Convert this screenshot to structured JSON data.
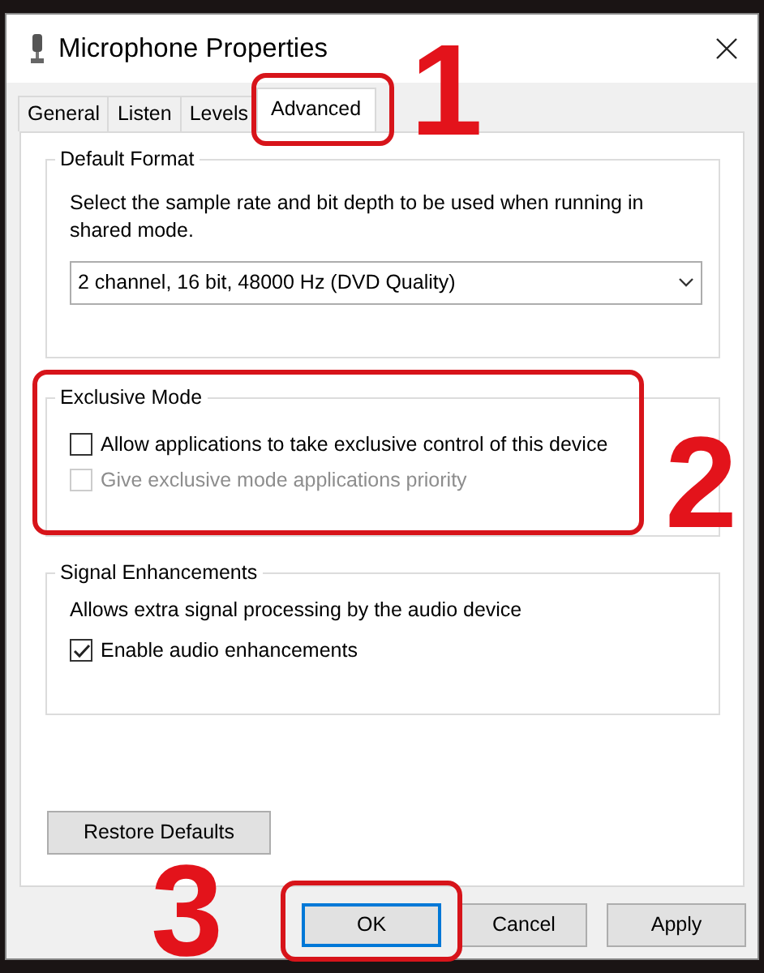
{
  "window": {
    "title": "Microphone Properties"
  },
  "tabs": [
    {
      "label": "General",
      "selected": false
    },
    {
      "label": "Listen",
      "selected": false
    },
    {
      "label": "Levels",
      "selected": false
    },
    {
      "label": "Advanced",
      "selected": true
    }
  ],
  "groups": [
    {
      "heading": "Default Format",
      "description": "Select the sample rate and bit depth to be used when running in shared mode.",
      "select": "2 channel, 16 bit, 48000 Hz (DVD Quality)"
    },
    {
      "heading": "Exclusive Mode",
      "options": [
        {
          "label": "Allow applications to take exclusive control of this device",
          "checked": false,
          "disabled": false
        },
        {
          "label": "Give exclusive mode applications priority",
          "checked": false,
          "disabled": true
        }
      ]
    },
    {
      "heading": "Signal Enhancements",
      "description": "Allows extra signal processing by the audio device",
      "options": [
        {
          "label": "Enable audio enhancements",
          "checked": true,
          "disabled": false
        }
      ]
    }
  ],
  "restore_button": "Restore Defaults",
  "buttons": [
    {
      "label": "OK",
      "focused": true
    },
    {
      "label": "Cancel",
      "focused": false
    },
    {
      "label": "Apply",
      "focused": false
    }
  ],
  "annotations": [
    {
      "number": "1"
    },
    {
      "number": "2"
    },
    {
      "number": "3"
    }
  ]
}
